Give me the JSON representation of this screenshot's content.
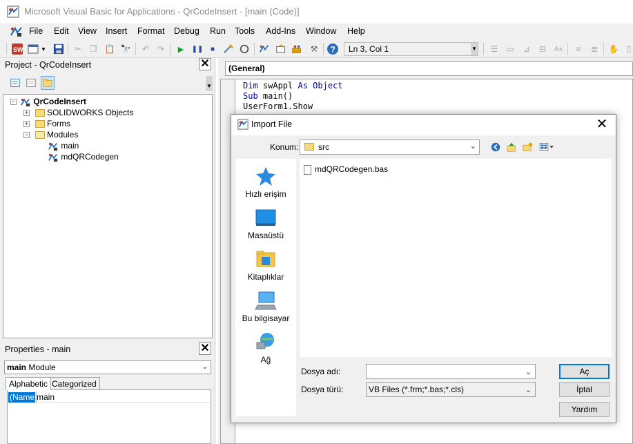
{
  "window": {
    "title": "Microsoft Visual Basic for Applications - QrCodeInsert - [main (Code)]"
  },
  "menu": {
    "items": [
      "File",
      "Edit",
      "View",
      "Insert",
      "Format",
      "Debug",
      "Run",
      "Tools",
      "Add-Ins",
      "Window",
      "Help"
    ]
  },
  "toolbar": {
    "position": "Ln 3, Col 1"
  },
  "project_panel": {
    "title": "Project - QrCodeInsert",
    "tree": {
      "root": "QrCodeInsert",
      "solidworks_objects": "SOLIDWORKS Objects",
      "forms": "Forms",
      "modules": "Modules",
      "module_main": "main",
      "module_qr": "mdQRCodegen"
    }
  },
  "properties_panel": {
    "title": "Properties - main",
    "object_name": "main",
    "object_type": "Module",
    "tabs": [
      "Alphabetic",
      "Categorized"
    ],
    "row": {
      "name": "(Name)",
      "value": "main"
    }
  },
  "code": {
    "combo": "(General)",
    "lines": [
      {
        "kw": "Dim",
        "rest": " swAppl ",
        "kw2": "As",
        "rest2": " ",
        "kw3": "Object"
      },
      {
        "kw": "Sub",
        "rest": " main()"
      },
      {
        "plain": "UserForm1.Show"
      }
    ]
  },
  "dialog": {
    "title": "Import File",
    "location_label": "Konum:",
    "location_value": "src",
    "places": [
      "Hızlı erişim",
      "Masaüstü",
      "Kitaplıklar",
      "Bu bilgisayar",
      "Ağ"
    ],
    "files": [
      "mdQRCodegen.bas"
    ],
    "filename_label": "Dosya adı:",
    "filename_value": "",
    "filetype_label": "Dosya türü:",
    "filetype_value": "VB Files (*.frm;*.bas;*.cls)",
    "buttons": {
      "open": "Aç",
      "cancel": "İptal",
      "help": "Yardım"
    }
  },
  "colors": {
    "keyword": "#00008b",
    "selection": "#0078d7",
    "folder": "#f5d97a"
  }
}
